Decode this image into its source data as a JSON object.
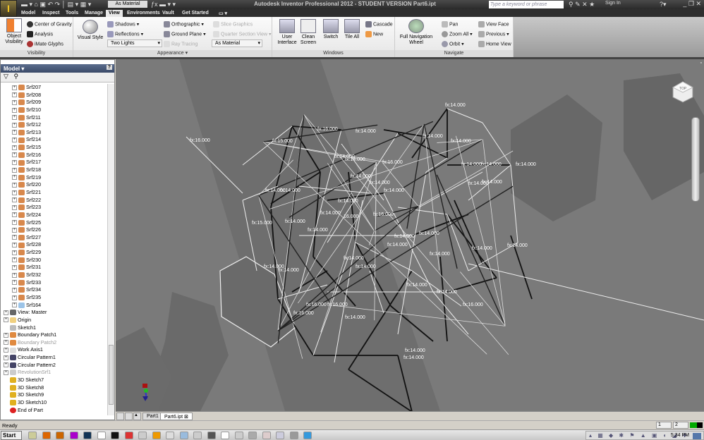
{
  "app": {
    "logo": "I",
    "logo_sub": "PRO",
    "title": "Autodesk Inventor Professional 2012 - STUDENT VERSION    Part6.ipt",
    "material_select": "As Material",
    "search_placeholder": "Type a keyword or phrase",
    "sign_in": "Sign In",
    "window_controls": "_ ❐ ✕"
  },
  "tabs": [
    {
      "label": "Model"
    },
    {
      "label": "Inspect"
    },
    {
      "label": "Tools"
    },
    {
      "label": "Manage"
    },
    {
      "label": "View",
      "active": true
    },
    {
      "label": "Environments"
    },
    {
      "label": "Vault"
    },
    {
      "label": "Get Started"
    }
  ],
  "ribbon": {
    "visibility": {
      "title": "Visibility",
      "object_visibility": "Object Visibility",
      "center_of_gravity": "Center of Gravity",
      "analysis": "Analysis",
      "imate_glyphs": "iMate Glyphs"
    },
    "appearance": {
      "title": "Appearance ▾",
      "visual_style": "Visual Style",
      "shadows": "Shadows",
      "reflections": "Reflections",
      "lighting": "Two Lights",
      "orthographic": "Orthographic",
      "ground_plane": "Ground Plane",
      "ray_tracing": "Ray Tracing",
      "slice_graphics": "Slice Graphics",
      "quarter_section": "Quarter Section View",
      "material": "As Material"
    },
    "windows": {
      "title": "Windows",
      "user_interface": "User Interface",
      "clean_screen": "Clean Screen",
      "switch": "Switch",
      "tile_all": "Tile All",
      "cascade": "Cascade",
      "new": "New"
    },
    "navigate": {
      "title": "Navigate",
      "wheel": "Full Navigation Wheel",
      "pan": "Pan",
      "zoom_all": "Zoom All",
      "orbit": "Orbit",
      "view_face": "View Face",
      "previous": "Previous",
      "home_view": "Home View"
    }
  },
  "browser": {
    "title": "Model ▾",
    "help": "?",
    "items": [
      {
        "label": "Srf207",
        "indent": 2,
        "type": "srf"
      },
      {
        "label": "Srf208",
        "indent": 2,
        "type": "srf"
      },
      {
        "label": "Srf209",
        "indent": 2,
        "type": "srf"
      },
      {
        "label": "Srf210",
        "indent": 2,
        "type": "srf"
      },
      {
        "label": "Srf211",
        "indent": 2,
        "type": "srf"
      },
      {
        "label": "Srf212",
        "indent": 2,
        "type": "srf"
      },
      {
        "label": "Srf213",
        "indent": 2,
        "type": "srf"
      },
      {
        "label": "Srf214",
        "indent": 2,
        "type": "srf"
      },
      {
        "label": "Srf215",
        "indent": 2,
        "type": "srf"
      },
      {
        "label": "Srf216",
        "indent": 2,
        "type": "srf"
      },
      {
        "label": "Srf217",
        "indent": 2,
        "type": "srf"
      },
      {
        "label": "Srf218",
        "indent": 2,
        "type": "srf"
      },
      {
        "label": "Srf219",
        "indent": 2,
        "type": "srf"
      },
      {
        "label": "Srf220",
        "indent": 2,
        "type": "srf"
      },
      {
        "label": "Srf221",
        "indent": 2,
        "type": "srf"
      },
      {
        "label": "Srf222",
        "indent": 2,
        "type": "srf"
      },
      {
        "label": "Srf223",
        "indent": 2,
        "type": "srf"
      },
      {
        "label": "Srf224",
        "indent": 2,
        "type": "srf"
      },
      {
        "label": "Srf225",
        "indent": 2,
        "type": "srf"
      },
      {
        "label": "Srf226",
        "indent": 2,
        "type": "srf"
      },
      {
        "label": "Srf227",
        "indent": 2,
        "type": "srf"
      },
      {
        "label": "Srf228",
        "indent": 2,
        "type": "srf"
      },
      {
        "label": "Srf229",
        "indent": 2,
        "type": "srf"
      },
      {
        "label": "Srf230",
        "indent": 2,
        "type": "srf"
      },
      {
        "label": "Srf231",
        "indent": 2,
        "type": "srf"
      },
      {
        "label": "Srf232",
        "indent": 2,
        "type": "srf"
      },
      {
        "label": "Srf233",
        "indent": 2,
        "type": "srf"
      },
      {
        "label": "Srf234",
        "indent": 2,
        "type": "srf"
      },
      {
        "label": "Srf235",
        "indent": 2,
        "type": "srf"
      },
      {
        "label": "Srf164",
        "indent": 2,
        "type": "srf-outline"
      },
      {
        "label": "View: Master",
        "indent": 1,
        "type": "view"
      },
      {
        "label": "Origin",
        "indent": 1,
        "type": "folder"
      },
      {
        "label": "Sketch1",
        "indent": 1,
        "type": "sketch",
        "noexpand": true
      },
      {
        "label": "Boundary Patch1",
        "indent": 1,
        "type": "patch"
      },
      {
        "label": "Boundary Patch2",
        "indent": 1,
        "type": "patch",
        "dim": true
      },
      {
        "label": "Work Axis1",
        "indent": 1,
        "type": "axis"
      },
      {
        "label": "Circular Pattern1",
        "indent": 1,
        "type": "pattern"
      },
      {
        "label": "Circular Pattern2",
        "indent": 1,
        "type": "pattern"
      },
      {
        "label": "RevolutionSrf1",
        "indent": 1,
        "type": "revolve",
        "dim": true
      },
      {
        "label": "3D Sketch7",
        "indent": 1,
        "type": "sketch3d",
        "noexpand": true
      },
      {
        "label": "3D Sketch8",
        "indent": 1,
        "type": "sketch3d",
        "noexpand": true
      },
      {
        "label": "3D Sketch9",
        "indent": 1,
        "type": "sketch3d",
        "noexpand": true
      },
      {
        "label": "3D Sketch10",
        "indent": 1,
        "type": "sketch3d",
        "noexpand": true
      },
      {
        "label": "End of Part",
        "indent": 1,
        "type": "end",
        "noexpand": true
      }
    ]
  },
  "viewport": {
    "viewcube_face": "TOP",
    "dimensions": [
      "fx:16.000",
      "fx:15.000",
      "fx:16.000",
      "fx:14.000",
      "fx:14.000",
      "fx:14.000",
      "fx:14.000",
      "fx:14.000",
      "fx:14.000",
      "fx:16.000",
      "fx:14.000",
      "fx:14.000",
      "fx:14.000",
      "fx:14.000",
      "fx:14.000",
      "fx:14.000",
      "fx:14.000",
      "fx:14.000",
      "fx:14.000",
      "fx:14.000",
      "fx:15.000",
      "fx:14.000",
      "fx:14.000",
      "16.000",
      "fx:16.000",
      "fx:14.000",
      "fx:14.000",
      "fx:14.000",
      "fx:14.000",
      "fx:14.000",
      "fx:14.000",
      "fx:14.000",
      "fx:14.000",
      "fx:14.000",
      "fx:14.000",
      "fx:14.000",
      "fx:16.000",
      "fx:14.000",
      "fx:14.000",
      "fx:14.000",
      "fx:14.000",
      "fx:16.000",
      "fx:16.000",
      "fx:16.000",
      "fx:14.000",
      "fx:14.000"
    ]
  },
  "doc_tabs": [
    {
      "label": "Part1"
    },
    {
      "label": "Part6.ipt",
      "active": true
    }
  ],
  "status": {
    "text": "Ready",
    "page1": "1",
    "page2": "2"
  },
  "taskbar": {
    "start": "Start",
    "clock": "5:34 PM"
  }
}
